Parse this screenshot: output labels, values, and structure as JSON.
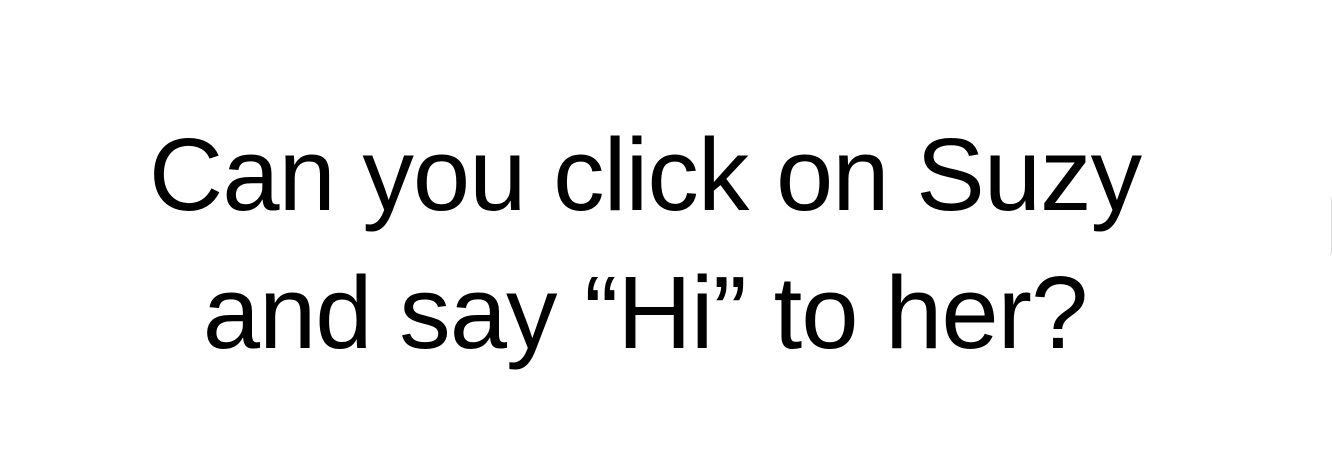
{
  "prompt": {
    "line1": "Can you click on Suzy",
    "line2": "and say “Hi” to her?"
  },
  "colors": {
    "background": "#ffffff",
    "text": "#000000"
  }
}
